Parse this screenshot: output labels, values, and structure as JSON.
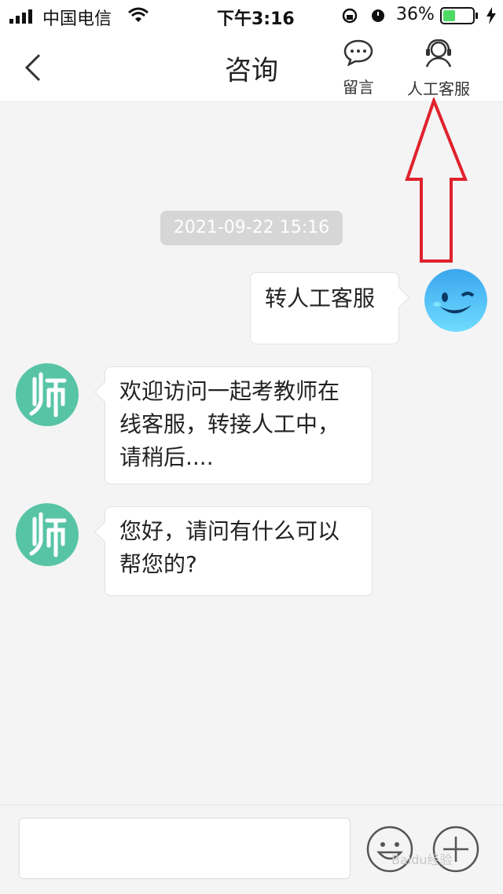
{
  "status_bar": {
    "carrier": "中国电信",
    "time": "下午3:16",
    "battery_percent": "36%"
  },
  "nav": {
    "title": "咨询",
    "leave_message_label": "留言",
    "human_service_label": "人工客服"
  },
  "chat": {
    "timestamp": "2021-09-22 15:16",
    "messages": [
      {
        "sender": "user",
        "text": "转人工客服"
      },
      {
        "sender": "agent",
        "avatar_char": "师",
        "text": "欢迎访问一起考教师在线客服，转接人工中，请稍后...."
      },
      {
        "sender": "agent",
        "avatar_char": "师",
        "text": "您好，请问有什么可以帮您的?"
      }
    ]
  },
  "bottom": {
    "input_placeholder": "",
    "watermark": "Baidu经验"
  },
  "colors": {
    "accent_green": "#58c4a6",
    "arrow_red": "#e0222d",
    "battery_green": "#4cd964"
  }
}
